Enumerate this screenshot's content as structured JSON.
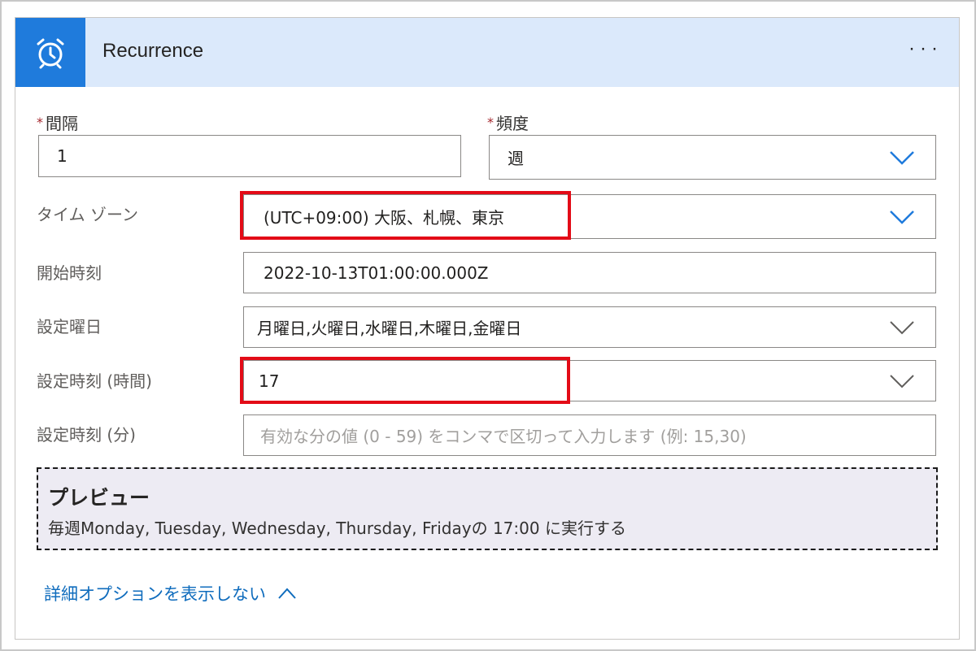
{
  "header": {
    "icon": "alarm-clock-icon",
    "title": "Recurrence",
    "more": "···"
  },
  "interval": {
    "required_mark": "*",
    "label": "間隔",
    "value": "1"
  },
  "frequency": {
    "required_mark": "*",
    "label": "頻度",
    "value": "週"
  },
  "timezone": {
    "label": "タイム ゾーン",
    "value": "(UTC+09:00) 大阪、札幌、東京"
  },
  "start_time": {
    "label": "開始時刻",
    "value": "2022-10-13T01:00:00.000Z"
  },
  "weekdays": {
    "label": "設定曜日",
    "value": "月曜日,火曜日,水曜日,木曜日,金曜日"
  },
  "hours": {
    "label": "設定時刻 (時間)",
    "value": "17"
  },
  "minutes": {
    "label": "設定時刻 (分)",
    "placeholder": "有効な分の値 (0 - 59) をコンマで区切って入力します (例: 15,30)"
  },
  "preview": {
    "title": "プレビュー",
    "text": "毎週Monday, Tuesday, Wednesday, Thursday, Fridayの 17:00 に実行する"
  },
  "advanced_options_link": "詳細オプションを表示しない",
  "colors": {
    "header_bg": "#dbe9fb",
    "icon_bg": "#1f7bdc",
    "link": "#0f6cbd",
    "highlight": "#e30b17",
    "preview_bg": "#edebf3"
  }
}
